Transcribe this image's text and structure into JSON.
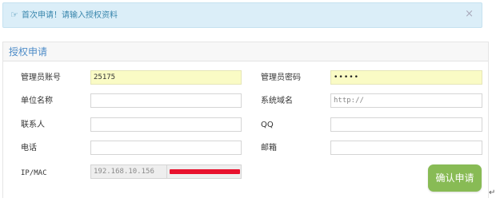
{
  "notice": {
    "message": "首次申请！请输入授权资料",
    "hand_icon": "hand-pointer-right-icon",
    "close_glyph": "×"
  },
  "panel": {
    "title": "授权申请"
  },
  "form": {
    "admin_account_label": "管理员账号",
    "admin_account_value": "25175",
    "admin_password_label": "管理员密码",
    "admin_password_value": "•••••",
    "org_name_label": "单位名称",
    "org_name_value": "",
    "domain_label": "系统域名",
    "domain_placeholder": "http://",
    "contact_label": "联系人",
    "contact_value": "",
    "qq_label": "QQ",
    "qq_value": "",
    "phone_label": "电话",
    "phone_value": "",
    "email_label": "邮箱",
    "email_value": "",
    "ipmac_label": "IP/MAC",
    "ip_value": "192.168.10.156"
  },
  "actions": {
    "confirm_label": "确认申请"
  },
  "colors": {
    "notice_bg": "#dbeef8",
    "title_blue": "#4e8cc8",
    "highlight_yellow": "#fafbc5",
    "button_green": "#88bb55",
    "redaction_red": "#e8112d"
  },
  "misc": {
    "return_glyph": "↵"
  }
}
